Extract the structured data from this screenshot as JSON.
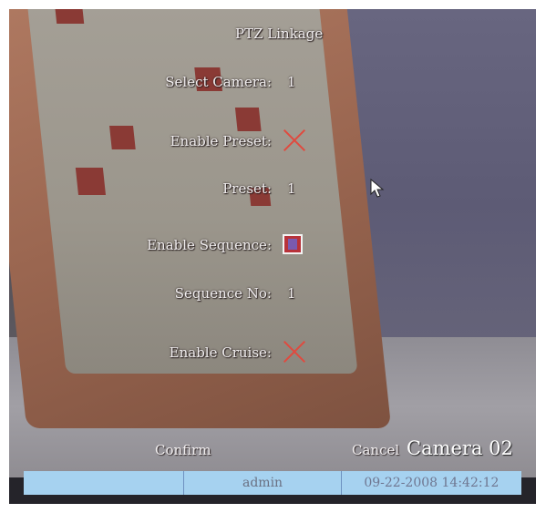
{
  "menu": {
    "title": "PTZ Linkage",
    "select_camera_label": "Select Camera:",
    "select_camera_value": "1",
    "enable_preset_label": "Enable Preset:",
    "enable_preset_state": "off",
    "preset_label": "Preset:",
    "preset_value": "1",
    "enable_sequence_label": "Enable Sequence:",
    "enable_sequence_state": "on",
    "sequence_no_label": "Sequence No:",
    "sequence_no_value": "1",
    "enable_cruise_label": "Enable Cruise:",
    "enable_cruise_state": "off"
  },
  "buttons": {
    "confirm": "Confirm",
    "cancel": "Cancel"
  },
  "camera_overlay": "Camera 02",
  "status_bar": {
    "user": "admin",
    "datetime": "09-22-2008 14:42:12"
  },
  "colors": {
    "status_bar_bg": "#a6d2f0",
    "cross_mark": "#e04a3f",
    "checkbox_fill": "#b8323a"
  },
  "icons": {
    "unchecked": "cross-icon",
    "checked": "checkbox-checked-icon",
    "pointer": "mouse-cursor-icon"
  }
}
